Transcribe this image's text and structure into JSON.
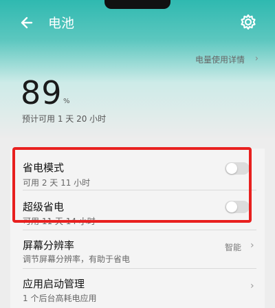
{
  "header": {
    "title": "电池",
    "back_icon": "arrow-left-icon",
    "settings_icon": "gear-icon",
    "detail_link": "电量使用详情",
    "detail_chevron": "›"
  },
  "battery": {
    "level": "89",
    "unit": "%",
    "remaining": "预计可用 1 天 20 小时"
  },
  "settings": [
    {
      "title": "省电模式",
      "subtitle": "可用 2 天 11 小时",
      "toggle_on": false
    },
    {
      "title": "超级省电",
      "subtitle": "可用 11 天 14 小时",
      "toggle_on": false
    },
    {
      "title": "屏幕分辨率",
      "subtitle": "调节屏幕分辨率，有助于省电",
      "value": "智能",
      "chevron": "›"
    },
    {
      "title": "应用启动管理",
      "subtitle": "1 个后台高耗电应用",
      "chevron": "›"
    }
  ],
  "colors": {
    "header_top": "#2fb9b0",
    "highlight_border": "#e8201f",
    "toggle_off": "#dcdcdc"
  }
}
